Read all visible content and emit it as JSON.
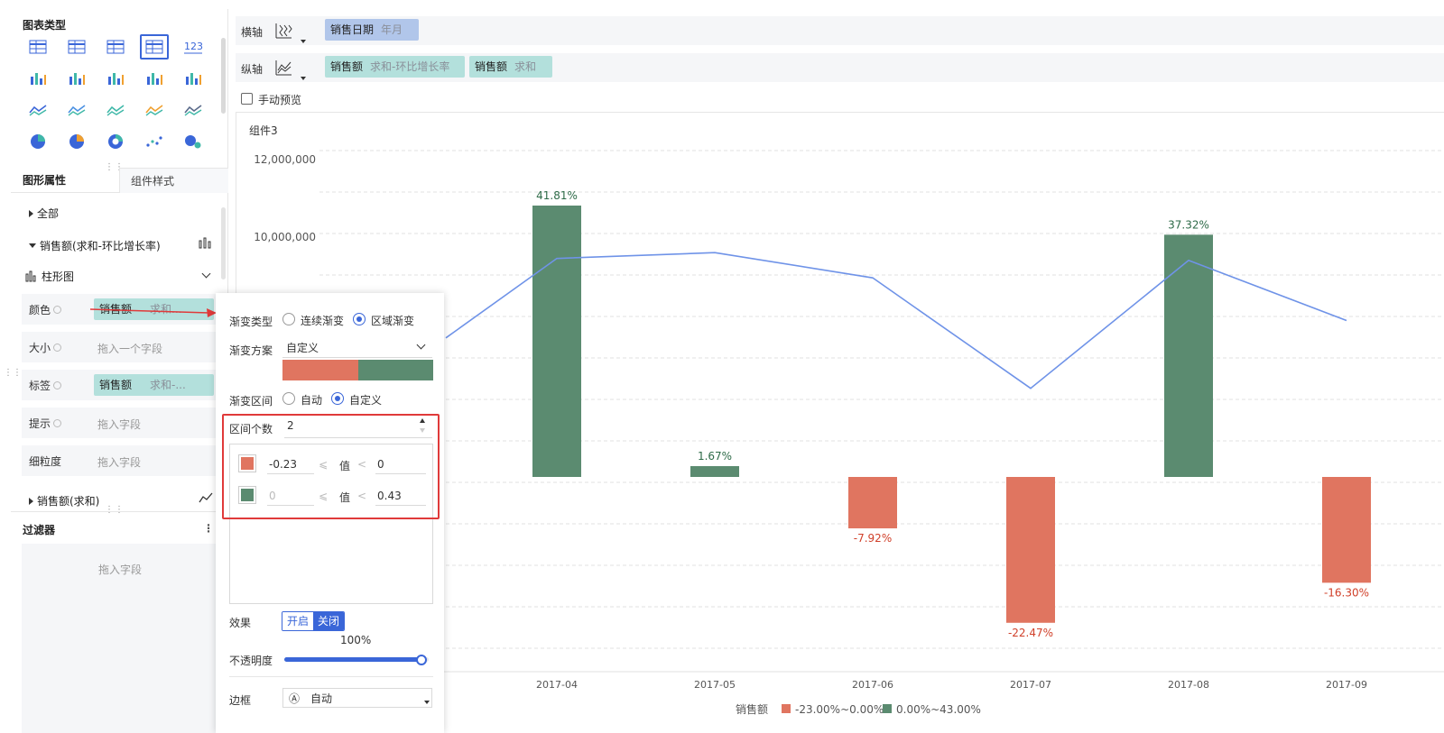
{
  "chart_types": {
    "title": "图表类型",
    "icons": [
      "table-icon",
      "cross-table-icon",
      "detail-table-icon",
      "kpi-card-icon",
      "number-icon",
      "stacked-bar-icon",
      "grouped-bar-icon",
      "bar-chart-icon",
      "horizontal-bar-icon",
      "waterfall-icon",
      "line-chart-icon",
      "radar-icon",
      "map-icon",
      "area-chart-icon",
      "gauge-icon",
      "pie-chart-icon",
      "rose-chart-icon",
      "donut-chart-icon",
      "scatter-icon",
      "bubble-icon"
    ]
  },
  "tabs": {
    "graphic": "图形属性",
    "component": "组件样式"
  },
  "tree": {
    "all": "全部",
    "series1": "销售额(求和-环比增长率)",
    "chart_type": "柱形图",
    "series2": "销售额(求和)"
  },
  "props": {
    "color": {
      "label": "颜色",
      "pill_main": "销售额",
      "pill_sub": "求和..."
    },
    "size": {
      "label": "大小",
      "placeholder": "拖入一个字段"
    },
    "label": {
      "label": "标签",
      "pill_main": "销售额",
      "pill_sub": "求和-..."
    },
    "tooltip": {
      "label": "提示",
      "placeholder": "拖入字段"
    },
    "granularity": {
      "label": "细粒度",
      "placeholder": "拖入字段"
    }
  },
  "filter": {
    "title": "过滤器",
    "placeholder": "拖入字段"
  },
  "axes": {
    "x_label": "横轴",
    "x_pill": {
      "main": "销售日期",
      "sub": "年月"
    },
    "y_label": "纵轴",
    "y_pills": [
      {
        "main": "销售额",
        "sub": "求和-环比增长率"
      },
      {
        "main": "销售额",
        "sub": "求和"
      }
    ],
    "manual_preview": "手动预览"
  },
  "popup": {
    "gradient_type": "渐变类型",
    "continuous": "连续渐变",
    "region": "区域渐变",
    "scheme_label": "渐变方案",
    "scheme_value": "自定义",
    "range_label": "渐变区间",
    "auto": "自动",
    "custom": "自定义",
    "count_label": "区间个数",
    "count_value": "2",
    "intervals": [
      {
        "color": "#e07560",
        "from": "-0.23",
        "to": "0",
        "from_disabled": false
      },
      {
        "color": "#5b8b70",
        "from": "0",
        "to": "0.43",
        "from_disabled": true
      }
    ],
    "le_symbol": "⩽",
    "lt_symbol": "<",
    "value_label": "值",
    "effect_label": "效果",
    "effect_on": "开启",
    "effect_off": "关闭",
    "opacity_label": "不透明度",
    "opacity_value": "100%",
    "opacity_fraction": 1.0,
    "border_label": "边框",
    "border_value": "自动",
    "border_icon": "Ⓐ"
  },
  "colors": {
    "negative": "#e07560",
    "positive": "#5b8b70",
    "line": "#6f93e8",
    "accent": "#3a66d8"
  },
  "chart_data": {
    "type": "bar",
    "title": "组件3",
    "categories": [
      "2017-04",
      "2017-05",
      "2017-06",
      "2017-07",
      "2017-08",
      "2017-09"
    ],
    "series": [
      {
        "name": "销售额",
        "kind": "bar",
        "values": [
          0.4181,
          0.0167,
          -0.0792,
          -0.2247,
          0.3732,
          -0.163
        ],
        "labels": [
          "41.81%",
          "1.67%",
          "-7.92%",
          "-22.47%",
          "37.32%",
          "-16.30%"
        ]
      },
      {
        "kind": "line",
        "values": [
          9450000,
          9600000,
          8950000,
          6100000,
          9400000,
          7850000
        ]
      }
    ],
    "line_entry_point": {
      "left_value": 7400000
    },
    "y_axis": {
      "ticks": [
        "12,000,000",
        "10,000,000"
      ],
      "tick_values": [
        12000000,
        10000000
      ],
      "ylim_line": [
        0,
        12000000
      ]
    },
    "bar_scale": {
      "zero_line_value": 0,
      "max_fraction": 0.43
    },
    "legend": {
      "title": "销售额",
      "entries": [
        "-23.00%~0.00%",
        "0.00%~43.00%"
      ]
    },
    "grid": true
  }
}
